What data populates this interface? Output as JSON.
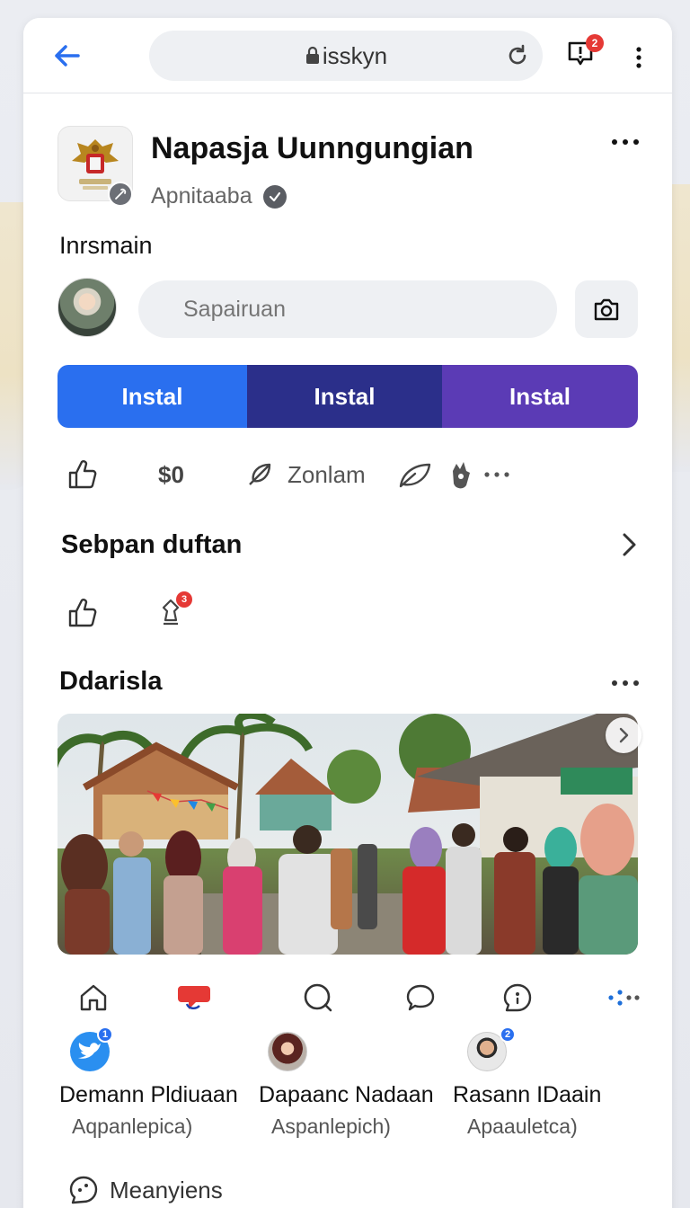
{
  "browser": {
    "url": "isskyn",
    "notification_count": "2"
  },
  "page": {
    "title": "Napasja Uunngungian",
    "subtitle": "Apnitaaba"
  },
  "composer": {
    "section_label": "Inrsmain",
    "search_placeholder": "Sapairuan"
  },
  "install_bar": {
    "buttons": [
      "Instal",
      "Instal",
      "Instal"
    ],
    "colors": [
      "#2a6fef",
      "#2b2f8a",
      "#5b3bb5"
    ]
  },
  "actions": {
    "count": "$0",
    "label": "Zonlam"
  },
  "list_section": {
    "title": "Sebpan duftan",
    "badge": "3"
  },
  "feed": {
    "title": "Ddarisla"
  },
  "people": [
    {
      "name": "Demann Pldiuaan",
      "sub": "Aqpanlepica)",
      "badge": "1"
    },
    {
      "name": "Dapaanc Nadaan",
      "sub": "Aspanlepich)",
      "badge": ""
    },
    {
      "name": "Rasann IDaain",
      "sub": "Apaauletca)",
      "badge": "2"
    }
  ],
  "footer": {
    "label": "Meanyiens"
  }
}
